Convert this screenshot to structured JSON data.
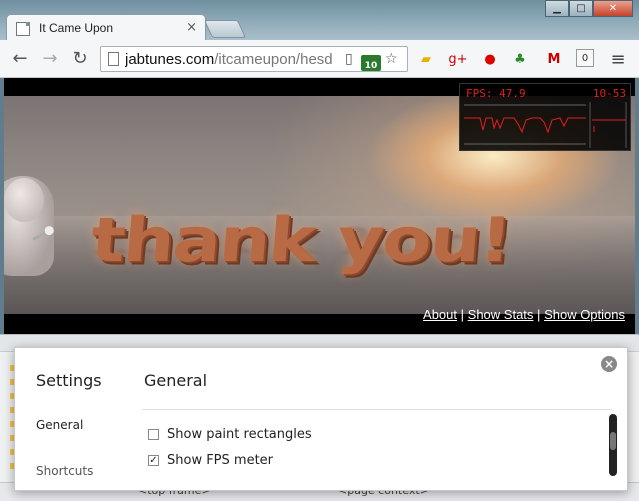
{
  "window": {
    "tab_title": "It Came Upon",
    "controls": [
      "minimize",
      "maximize",
      "close"
    ]
  },
  "toolbar": {
    "url_domain": "jabtunes.com",
    "url_path": "/itcameupon/hesd",
    "badge_count": "10",
    "ext_count": "0"
  },
  "page": {
    "hero_text": "thank you!",
    "links": {
      "about": "About",
      "separator": "|",
      "stats": "Show Stats",
      "options": "Show Options"
    }
  },
  "fps_meter": {
    "label": "FPS: 47.9",
    "range": "10-53",
    "color": "#e02020"
  },
  "devtools": {
    "status_frame": "<top frame>",
    "status_context": "<page context>"
  },
  "settings_dialog": {
    "nav_title": "Settings",
    "nav_items": [
      "General",
      "Shortcuts"
    ],
    "section_title": "General",
    "options": [
      {
        "label": "Show paint rectangles",
        "checked": false
      },
      {
        "label": "Show FPS meter",
        "checked": true
      }
    ]
  }
}
